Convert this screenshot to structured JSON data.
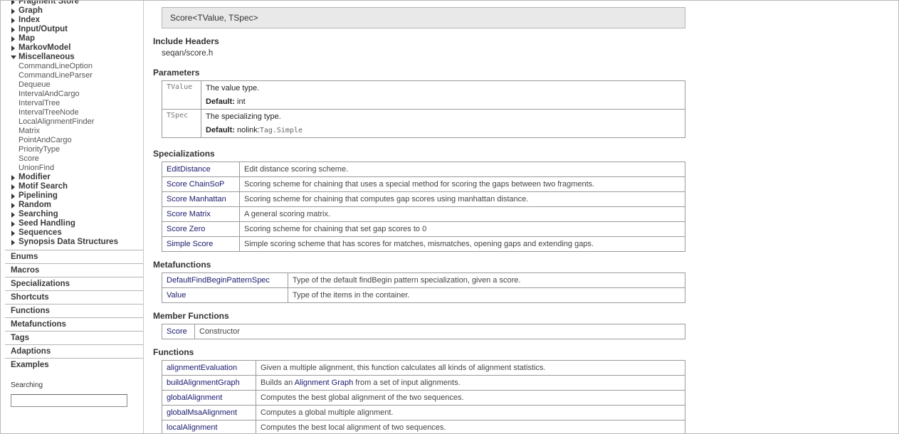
{
  "sidebar": {
    "tree": [
      {
        "type": "node",
        "label": "Fragment Store",
        "open": false
      },
      {
        "type": "node",
        "label": "Graph",
        "open": false
      },
      {
        "type": "node",
        "label": "Index",
        "open": false
      },
      {
        "type": "node",
        "label": "Input/Output",
        "open": false
      },
      {
        "type": "node",
        "label": "Map",
        "open": false
      },
      {
        "type": "node",
        "label": "MarkovModel",
        "open": false
      },
      {
        "type": "node",
        "label": "Miscellaneous",
        "open": true
      },
      {
        "type": "leaf",
        "label": "CommandLineOption"
      },
      {
        "type": "leaf",
        "label": "CommandLineParser"
      },
      {
        "type": "leaf",
        "label": "Dequeue"
      },
      {
        "type": "leaf",
        "label": "IntervalAndCargo"
      },
      {
        "type": "leaf",
        "label": "IntervalTree"
      },
      {
        "type": "leaf",
        "label": "IntervalTreeNode"
      },
      {
        "type": "leaf",
        "label": "LocalAlignmentFinder"
      },
      {
        "type": "leaf",
        "label": "Matrix"
      },
      {
        "type": "leaf",
        "label": "PointAndCargo"
      },
      {
        "type": "leaf",
        "label": "PriorityType"
      },
      {
        "type": "leaf",
        "label": "Score"
      },
      {
        "type": "leaf",
        "label": "UnionFind"
      },
      {
        "type": "node",
        "label": "Modifier",
        "open": false
      },
      {
        "type": "node",
        "label": "Motif Search",
        "open": false
      },
      {
        "type": "node",
        "label": "Pipelining",
        "open": false
      },
      {
        "type": "node",
        "label": "Random",
        "open": false
      },
      {
        "type": "node",
        "label": "Searching",
        "open": false
      },
      {
        "type": "node",
        "label": "Seed Handling",
        "open": false
      },
      {
        "type": "node",
        "label": "Sequences",
        "open": false
      },
      {
        "type": "node",
        "label": "Synopsis Data Structures",
        "open": false
      }
    ],
    "sections": [
      "Enums",
      "Macros",
      "Specializations",
      "Shortcuts",
      "Functions",
      "Metafunctions",
      "Tags",
      "Adaptions",
      "Examples"
    ],
    "search": {
      "label": "Searching",
      "value": ""
    }
  },
  "main": {
    "signature": "Score<TValue, TSpec>",
    "include_heading": "Include Headers",
    "include_value": "seqan/score.h",
    "parameters_heading": "Parameters",
    "parameters": [
      {
        "name": "TValue",
        "desc": "The value type.",
        "default_label": "Default:",
        "default_prefix": "",
        "default_value": "int",
        "default_mono": false
      },
      {
        "name": "TSpec",
        "desc": "The specializing type.",
        "default_label": "Default:",
        "default_prefix": "nolink:",
        "default_value": "Tag.Simple",
        "default_mono": true
      }
    ],
    "specializations_heading": "Specializations",
    "specializations": [
      {
        "name": "EditDistance",
        "desc": "Edit distance scoring scheme."
      },
      {
        "name": "Score ChainSoP",
        "desc": "Scoring scheme for chaining that uses a special method for scoring the gaps between two fragments."
      },
      {
        "name": "Score Manhattan",
        "desc": "Scoring scheme for chaining that computes gap scores using manhattan distance."
      },
      {
        "name": "Score Matrix",
        "desc": "A general scoring matrix."
      },
      {
        "name": "Score Zero",
        "desc": "Scoring scheme for chaining that set gap scores to 0"
      },
      {
        "name": "Simple Score",
        "desc": "Simple scoring scheme that has scores for matches, mismatches, opening gaps and extending gaps."
      }
    ],
    "metafunctions_heading": "Metafunctions",
    "metafunctions": [
      {
        "name": "DefaultFindBeginPatternSpec",
        "desc": "Type of the default findBegin pattern specialization, given a score."
      },
      {
        "name": "Value",
        "desc": "Type of the items in the container."
      }
    ],
    "member_functions_heading": "Member Functions",
    "member_functions": [
      {
        "name": "Score",
        "desc": "Constructor"
      }
    ],
    "functions_heading": "Functions",
    "functions": [
      {
        "name": "alignmentEvaluation",
        "desc": "Given a multiple alignment, this function calculates all kinds of alignment statistics."
      },
      {
        "name": "buildAlignmentGraph",
        "desc_pre": "Builds an ",
        "desc_link": "Alignment Graph",
        "desc_post": " from a set of input alignments."
      },
      {
        "name": "globalAlignment",
        "desc": "Computes the best global alignment of the two sequences."
      },
      {
        "name": "globalMsaAlignment",
        "desc": "Computes a global multiple alignment."
      },
      {
        "name": "localAlignment",
        "desc": "Computes the best local alignment of two sequences."
      }
    ]
  }
}
